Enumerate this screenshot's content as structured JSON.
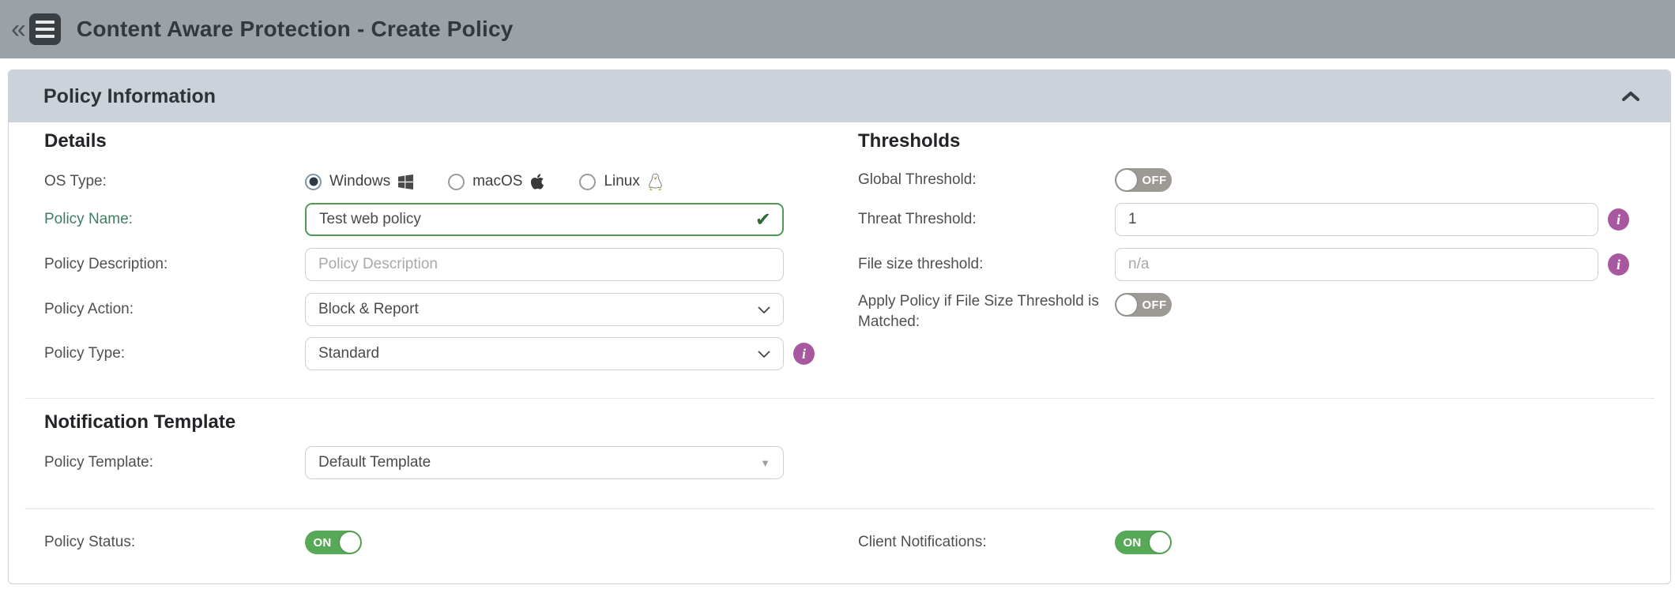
{
  "topbar": {
    "back_glyph": "«",
    "title": "Content Aware Protection - Create Policy"
  },
  "panel": {
    "title": "Policy Information"
  },
  "details": {
    "heading": "Details",
    "os_type": {
      "label": "OS Type:",
      "options": [
        {
          "label": "Windows",
          "icon": "windows-logo",
          "selected": true
        },
        {
          "label": "macOS",
          "icon": "apple-logo",
          "selected": false
        },
        {
          "label": "Linux",
          "icon": "linux-logo",
          "selected": false
        }
      ]
    },
    "policy_name": {
      "label": "Policy Name:",
      "value": "Test web policy",
      "valid_mark": "✔"
    },
    "policy_description": {
      "label": "Policy Description:",
      "placeholder": "Policy Description"
    },
    "policy_action": {
      "label": "Policy Action:",
      "value": "Block & Report"
    },
    "policy_type": {
      "label": "Policy Type:",
      "value": "Standard",
      "info_glyph": "i"
    }
  },
  "thresholds": {
    "heading": "Thresholds",
    "global_threshold": {
      "label": "Global Threshold:",
      "state": "OFF"
    },
    "threat_threshold": {
      "label": "Threat Threshold:",
      "value": "1",
      "info_glyph": "i"
    },
    "file_size_threshold": {
      "label": "File size threshold:",
      "placeholder": "n/a",
      "info_glyph": "i"
    },
    "apply_policy_if_matched": {
      "label": "Apply Policy if File Size Threshold is Matched:",
      "state": "OFF"
    }
  },
  "notification_template": {
    "heading": "Notification Template",
    "policy_template": {
      "label": "Policy Template:",
      "value": "Default Template"
    }
  },
  "status_row": {
    "policy_status": {
      "label": "Policy Status:",
      "state": "ON"
    },
    "client_notifications": {
      "label": "Client Notifications:",
      "state": "ON"
    }
  },
  "colors": {
    "topbar_gray": "#9aa1a7",
    "panel_header_gray": "#cbd2d9",
    "valid_green": "#4e9a55",
    "toggle_on_green": "#57a857",
    "toggle_off_gray": "#9d9a95",
    "info_purple": "#a7589e"
  }
}
